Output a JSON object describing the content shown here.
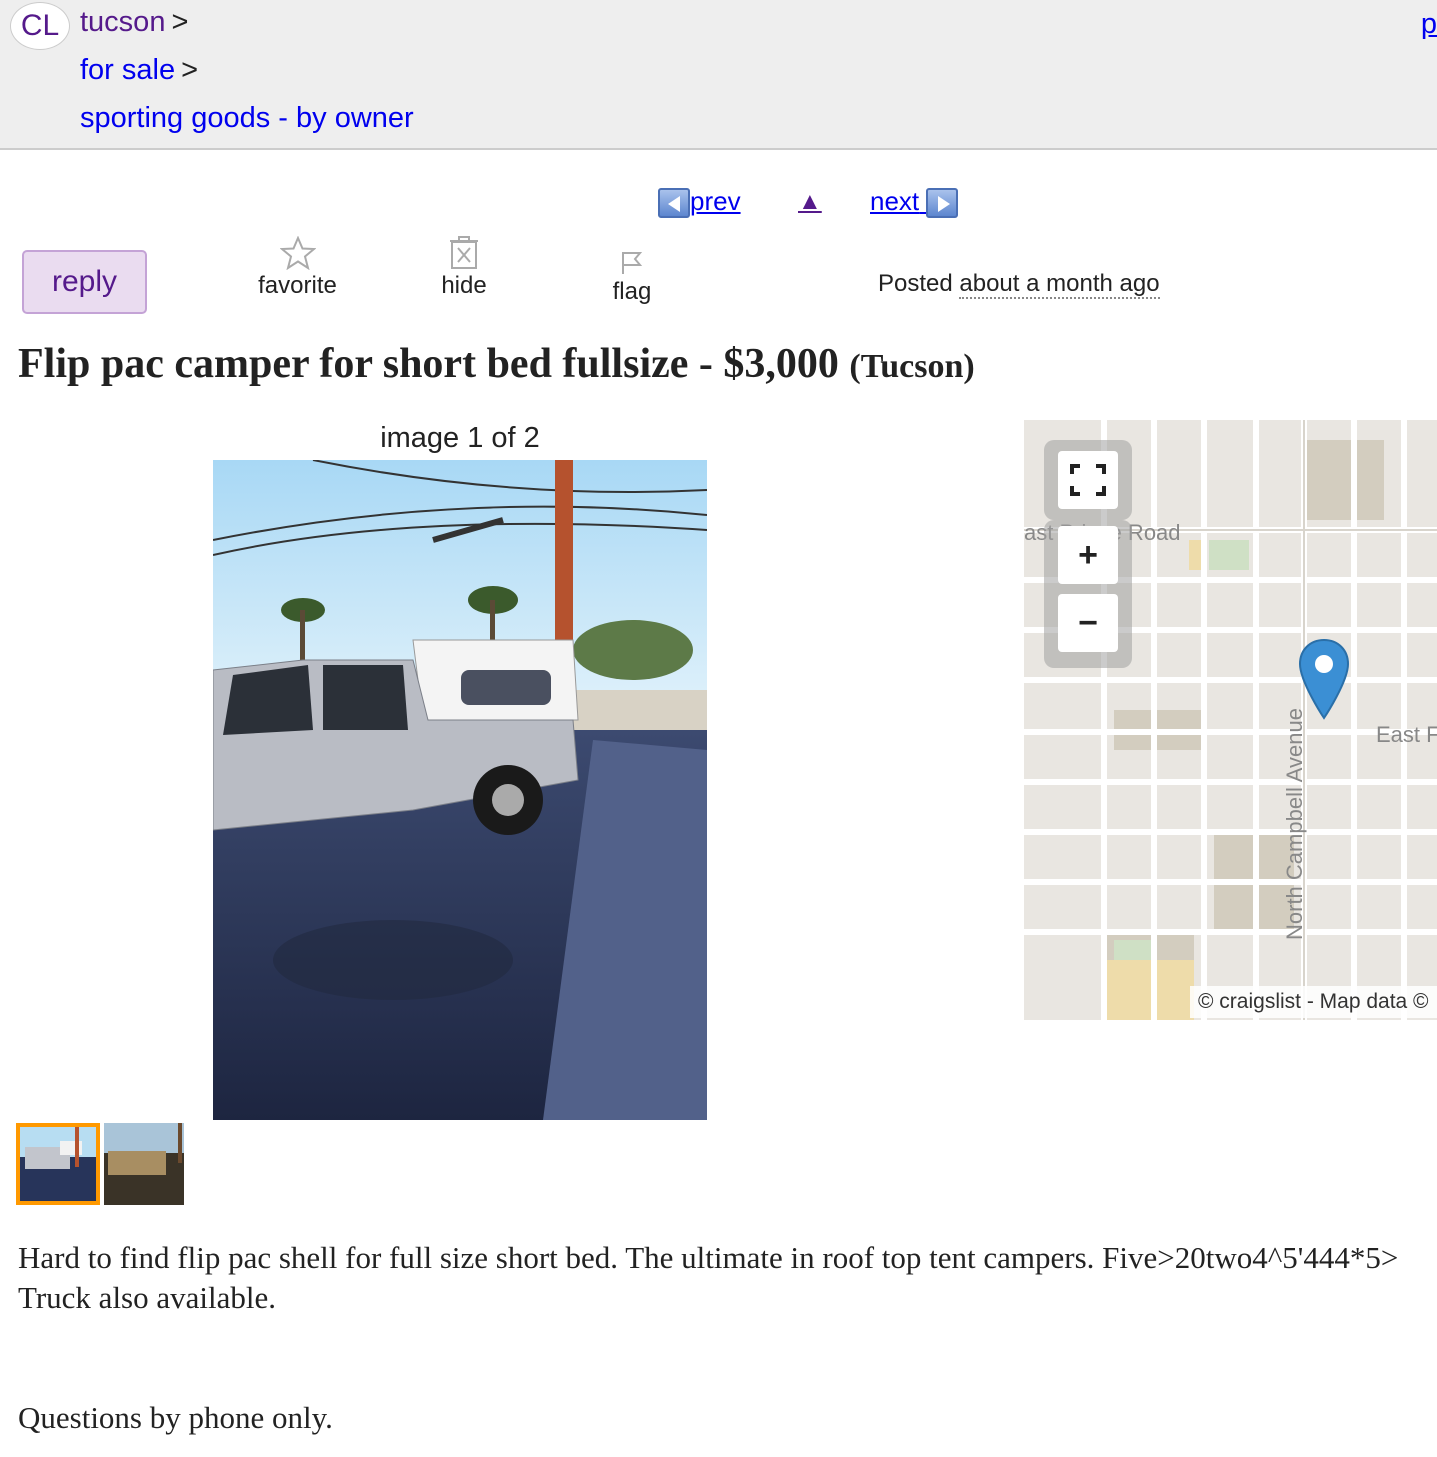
{
  "header": {
    "logo": "CL",
    "breadcrumbs": [
      {
        "label": "tucson",
        "sep": ">"
      },
      {
        "label": "for sale",
        "sep": ">"
      },
      {
        "label": "sporting goods - by owner",
        "sep": ""
      }
    ],
    "corner_letter": "p"
  },
  "nav": {
    "prev": "prev",
    "up": "▲",
    "next": "next"
  },
  "actions": {
    "reply": "reply",
    "favorite": "favorite",
    "hide": "hide",
    "flag": "flag"
  },
  "posted": {
    "prefix": "Posted",
    "when": "about a month ago"
  },
  "title": {
    "text": "Flip pac camper for short bed fullsize - $3,000",
    "location": "(Tucson)"
  },
  "gallery": {
    "counter": "image 1 of 2",
    "thumbnails": 2,
    "active_index": 0
  },
  "map": {
    "labels": {
      "prince_road": "ast Prince Road",
      "campbell": "North Campbell Avenue",
      "east": "East F"
    },
    "attribution": "© craigslist - Map data ©"
  },
  "body": {
    "line1": "Hard to find flip pac shell for full size short bed. The ultimate in roof top tent campers. Five>20two4^5'444*5>",
    "line2": "Truck also available.",
    "line3": "Questions by phone only."
  },
  "colors": {
    "link": "#0000ee",
    "visited": "#551a8b",
    "reply_bg": "#eadcf0",
    "thumb_active": "#ff9900",
    "map_pin": "#3b8fd4"
  }
}
